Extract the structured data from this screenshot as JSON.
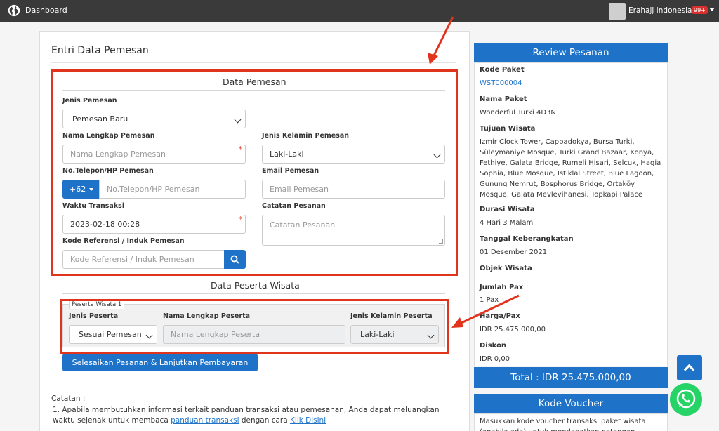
{
  "topbar": {
    "dashboard_label": "Dashboard",
    "user_name": "Erahajj Indonesia",
    "notif_badge": "99+"
  },
  "page": {
    "title": "Entri Data Pemesan"
  },
  "data_pemesan": {
    "section_title": "Data Pemesan",
    "jenis_pemesan_label": "Jenis Pemesan",
    "jenis_pemesan_value": "Pemesan Baru",
    "nama_label": "Nama Lengkap Pemesan",
    "nama_placeholder": "Nama Lengkap Pemesan",
    "jenis_kelamin_label": "Jenis Kelamin Pemesan",
    "jenis_kelamin_value": "Laki-Laki",
    "telepon_label": "No.Telepon/HP Pemesan",
    "telepon_prefix": "+62",
    "telepon_placeholder": "No.Telepon/HP Pemesan",
    "email_label": "Email Pemesan",
    "email_placeholder": "Email Pemesan",
    "waktu_label": "Waktu Transaksi",
    "waktu_value": "2023-02-18 00:28",
    "catatan_label": "Catatan Pesanan",
    "catatan_placeholder": "Catatan Pesanan",
    "kode_ref_label": "Kode Referensi / Induk Pemesan",
    "kode_ref_placeholder": "Kode Referensi / Induk Pemesan",
    "required_mark": "*"
  },
  "data_peserta": {
    "section_title": "Data Peserta Wisata",
    "group_legend": "Peserta Wisata 1",
    "jenis_peserta_label": "Jenis Peserta",
    "jenis_peserta_value": "Sesuai Pemesan",
    "nama_peserta_label": "Nama Lengkap Peserta",
    "nama_peserta_placeholder": "Nama Lengkap Peserta",
    "jenis_kelamin_peserta_label": "Jenis Kelamin Peserta",
    "jenis_kelamin_peserta_value": "Laki-Laki"
  },
  "submit_label": "Selesaikan Pesanan & Lanjutkan Pembayaran",
  "catatan": {
    "title": "Catatan :",
    "item1_prefix": "1. Apabila membutuhkan informasi terkait panduan transaksi atau pemesanan, Anda dapat meluangkan waktu sejenak untuk membaca ",
    "item1_link1": "panduan transaksi",
    "item1_middle": " dengan cara ",
    "item1_link2": "Klik Disini"
  },
  "review": {
    "title": "Review Pesanan",
    "kode_paket_label": "Kode Paket",
    "kode_paket_value": "WST000004",
    "nama_paket_label": "Nama Paket",
    "nama_paket_value": "Wonderful Turki 4D3N",
    "tujuan_label": "Tujuan Wisata",
    "tujuan_value": "Izmir Clock Tower, Cappadokya, Bursa Turki, Süleymaniye Mosque, Turki Grand Bazaar, Konya, Fethiye, Galata Bridge, Rumeli Hisari, Selcuk, Hagia Sophia, Blue Mosque, Istiklal Street, Blue Lagoon, Gunung Nemrut, Bosphorus Bridge, Ortaköy Mosque, Galata Mevlevihanesi, Topkapi Palace",
    "durasi_label": "Durasi Wisata",
    "durasi_value": "4 Hari 3 Malam",
    "tanggal_label": "Tanggal Keberangkatan",
    "tanggal_value": "01 Desember 2021",
    "objek_label": "Objek Wisata",
    "jumlah_label": "Jumlah Pax",
    "jumlah_value": "1 Pax",
    "harga_label": "Harga/Pax",
    "harga_value": "IDR 25.475.000,00",
    "diskon_label": "Diskon",
    "diskon_value": "IDR 0,00",
    "total": "Total : IDR 25.475.000,00"
  },
  "voucher": {
    "title": "Kode Voucher",
    "text": "Masukkan kode voucher transaksi paket wisata (apabila ada) untuk mendapatkan potongan"
  },
  "colors": {
    "primary": "#1e73c9",
    "highlight": "#e0341d",
    "topbar": "#3a3a3a",
    "whatsapp": "#25d366"
  }
}
